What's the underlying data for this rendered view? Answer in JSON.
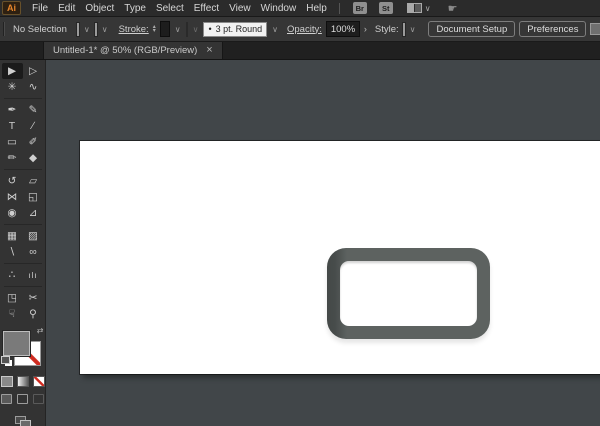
{
  "menubar": {
    "logo": "Ai",
    "items": [
      "File",
      "Edit",
      "Object",
      "Type",
      "Select",
      "Effect",
      "View",
      "Window",
      "Help"
    ],
    "bridge_label": "Br",
    "stock_label": "St",
    "workspace_chevron": "∨"
  },
  "controlbar": {
    "no_selection_label": "No Selection",
    "fill_chevron": "∨",
    "stroke_none_chevron": "∨",
    "stroke_label": "Stroke:",
    "stepper_up": "▴",
    "stepper_down": "▾",
    "stroke_weight_value": "",
    "stroke_weight_chevron": "∨",
    "profile_chevron": "∨",
    "brush_dot": "•",
    "brush_value": "3 pt. Round",
    "brush_chevron": "∨",
    "opacity_label": "Opacity:",
    "opacity_value": "100%",
    "opacity_arrow": "›",
    "style_label": "Style:",
    "style_chevron": "∨",
    "document_setup_label": "Document Setup",
    "preferences_label": "Preferences"
  },
  "tabbar": {
    "tab_title": "Untitled-1* @ 50% (RGB/Preview)",
    "close_glyph": "×"
  },
  "toolbar": {
    "tools": [
      {
        "name": "selection-tool",
        "glyph": "▶"
      },
      {
        "name": "direct-selection-tool",
        "glyph": "▷"
      },
      {
        "name": "magic-wand-tool",
        "glyph": "✳"
      },
      {
        "name": "lasso-tool",
        "glyph": "∿"
      },
      {
        "name": "pen-tool",
        "glyph": "✒"
      },
      {
        "name": "curvature-tool",
        "glyph": "✎"
      },
      {
        "name": "type-tool",
        "glyph": "T"
      },
      {
        "name": "line-segment-tool",
        "glyph": "∕"
      },
      {
        "name": "rectangle-tool",
        "glyph": "▭"
      },
      {
        "name": "paintbrush-tool",
        "glyph": "✐"
      },
      {
        "name": "pencil-tool",
        "glyph": "✏"
      },
      {
        "name": "eraser-tool",
        "glyph": "◆"
      },
      {
        "name": "rotate-tool",
        "glyph": "↺"
      },
      {
        "name": "scale-tool",
        "glyph": "▱"
      },
      {
        "name": "width-tool",
        "glyph": "⋈"
      },
      {
        "name": "free-transform-tool",
        "glyph": "◱"
      },
      {
        "name": "shape-builder-tool",
        "glyph": "◉"
      },
      {
        "name": "perspective-grid-tool",
        "glyph": "⊿"
      },
      {
        "name": "mesh-tool",
        "glyph": "▦"
      },
      {
        "name": "gradient-tool",
        "glyph": "▨"
      },
      {
        "name": "eyedropper-tool",
        "glyph": "∖"
      },
      {
        "name": "blend-tool",
        "glyph": "∞"
      },
      {
        "name": "symbol-sprayer-tool",
        "glyph": "∴"
      },
      {
        "name": "column-graph-tool",
        "glyph": "ılı"
      },
      {
        "name": "artboard-tool",
        "glyph": "◳"
      },
      {
        "name": "slice-tool",
        "glyph": "✂"
      },
      {
        "name": "hand-tool",
        "glyph": "☟"
      },
      {
        "name": "zoom-tool",
        "glyph": "⚲"
      }
    ],
    "swap_glyph": "⇄"
  },
  "colors": {
    "menubar_bg": "#2b2b2b",
    "panel_bg": "#333333",
    "accent_orange": "#e8862c",
    "none_red": "#cf2b20",
    "canvas_bg": "#414649",
    "artboard_white": "#ffffff",
    "shape_frame_gray": "#5d6260",
    "shape_frame_shadow": "#474c4b"
  }
}
